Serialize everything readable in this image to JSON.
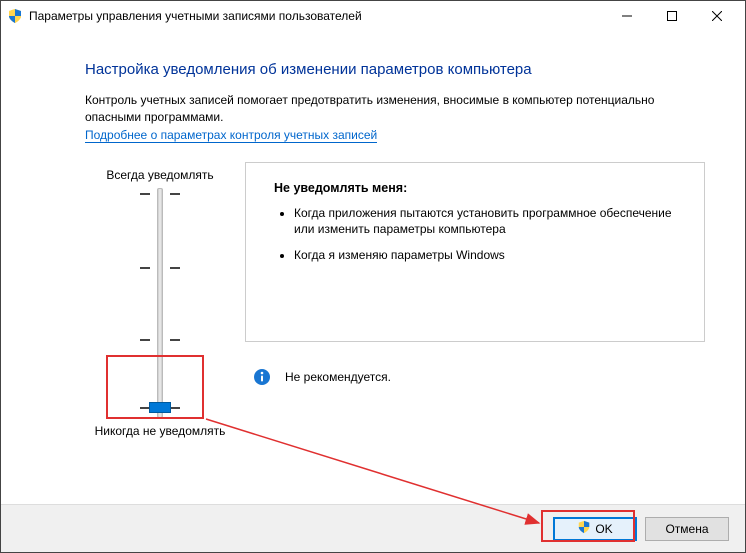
{
  "window": {
    "title": "Параметры управления учетными записями пользователей"
  },
  "heading": "Настройка уведомления об изменении параметров компьютера",
  "description": "Контроль учетных записей помогает предотвратить изменения, вносимые в компьютер потенциально опасными программами.",
  "link_text": "Подробнее о параметрах контроля учетных записей",
  "slider": {
    "top_label": "Всегда уведомлять",
    "bottom_label": "Никогда не уведомлять"
  },
  "panel": {
    "title": "Не уведомлять меня:",
    "items": [
      "Когда приложения пытаются установить программное обеспечение или изменить параметры компьютера",
      "Когда я изменяю параметры Windows"
    ],
    "warning": "Не рекомендуется."
  },
  "buttons": {
    "ok": "OK",
    "cancel": "Отмена"
  }
}
